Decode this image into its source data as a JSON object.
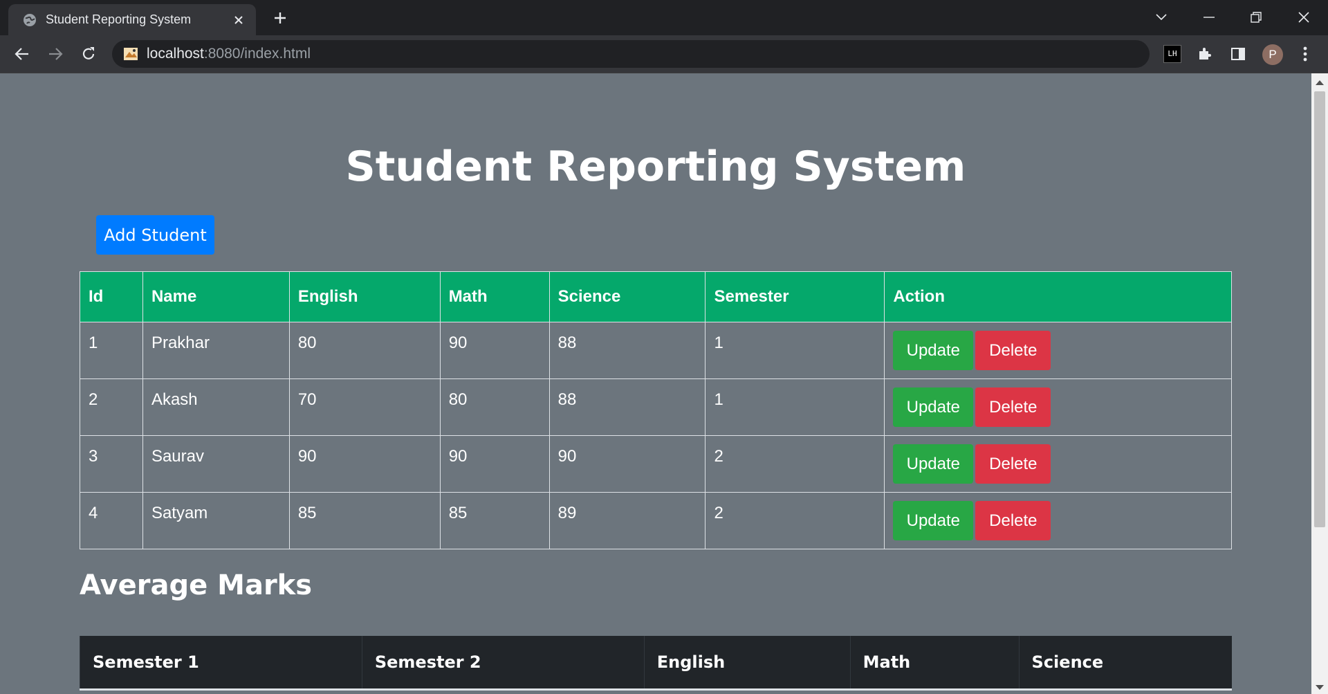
{
  "browser": {
    "tab_title": "Student Reporting System",
    "url_host": "localhost",
    "url_rest": ":8080/index.html",
    "profile_initial": "P",
    "extension_label": "LH"
  },
  "page": {
    "title": "Student Reporting System",
    "add_button": "Add Student",
    "table_headers": [
      "Id",
      "Name",
      "English",
      "Math",
      "Science",
      "Semester",
      "Action"
    ],
    "students": [
      {
        "id": "1",
        "name": "Prakhar",
        "english": "80",
        "math": "90",
        "science": "88",
        "semester": "1"
      },
      {
        "id": "2",
        "name": "Akash",
        "english": "70",
        "math": "80",
        "science": "88",
        "semester": "1"
      },
      {
        "id": "3",
        "name": "Saurav",
        "english": "90",
        "math": "90",
        "science": "90",
        "semester": "2"
      },
      {
        "id": "4",
        "name": "Satyam",
        "english": "85",
        "math": "85",
        "science": "89",
        "semester": "2"
      }
    ],
    "update_label": "Update",
    "delete_label": "Delete",
    "average_title": "Average Marks",
    "average_headers": [
      "Semester 1",
      "Semester 2",
      "English",
      "Math",
      "Science"
    ]
  },
  "colors": {
    "page_bg": "#6c757d",
    "primary": "#007bff",
    "header_green": "#05a86b",
    "update_green": "#28a745",
    "delete_red": "#dc3545",
    "dark_header": "#212529"
  }
}
